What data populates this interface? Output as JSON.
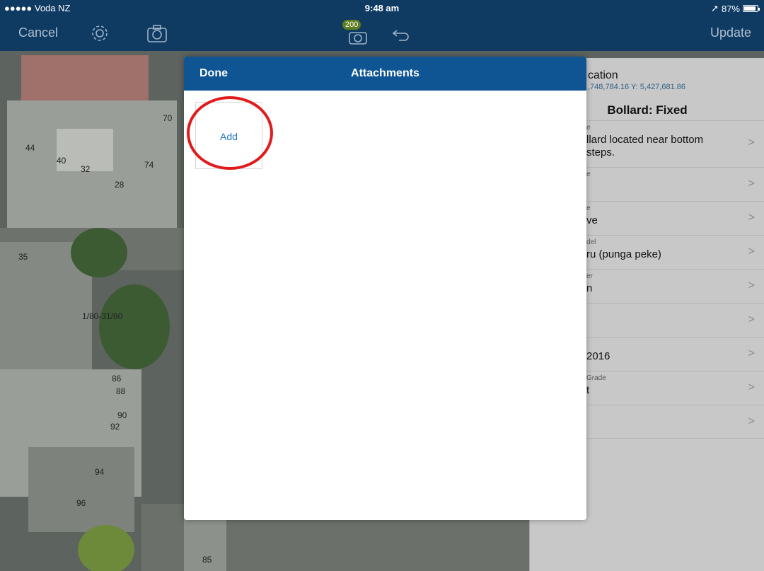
{
  "status_bar": {
    "carrier": "●●●●● Voda NZ ",
    "time": "9:48 am",
    "battery_percent": "87%"
  },
  "nav_bar": {
    "cancel_label": "Cancel",
    "update_label": "Update",
    "badge_count": "200",
    "icons": [
      "gear-icon",
      "camera-icon",
      "camera-badge-icon",
      "undo-icon"
    ]
  },
  "map": {
    "numbers": [
      "70",
      "44",
      "40",
      "32",
      "74",
      "28",
      "35",
      "1/80-31/80",
      "86",
      "88",
      "90",
      "92",
      "94",
      "96",
      "85"
    ]
  },
  "feature_panel": {
    "title_partial": "cation",
    "coords_partial": ",748,784.16 Y: 5,427,681.86",
    "heading": "Bollard: Fixed",
    "rows": [
      {
        "label": "e",
        "value": "llard located near bottom\n steps."
      },
      {
        "label": "e",
        "value": ""
      },
      {
        "label": "e",
        "value": "ve"
      },
      {
        "label": "del",
        "value": "ru (punga peke)"
      },
      {
        "label": "er",
        "value": "n"
      },
      {
        "label": "",
        "value": ""
      },
      {
        "label": "",
        "value": "2016"
      },
      {
        "label": "Grade",
        "value": "t"
      },
      {
        "label": "",
        "value": ""
      }
    ]
  },
  "modal": {
    "done_label": "Done",
    "title": "Attachments",
    "add_label": "Add"
  },
  "colors": {
    "nav_bg": "#0f3b63",
    "modal_header_bg": "#0f5593",
    "link_blue": "#1f7ac6",
    "highlight_red": "#e11b1b"
  }
}
